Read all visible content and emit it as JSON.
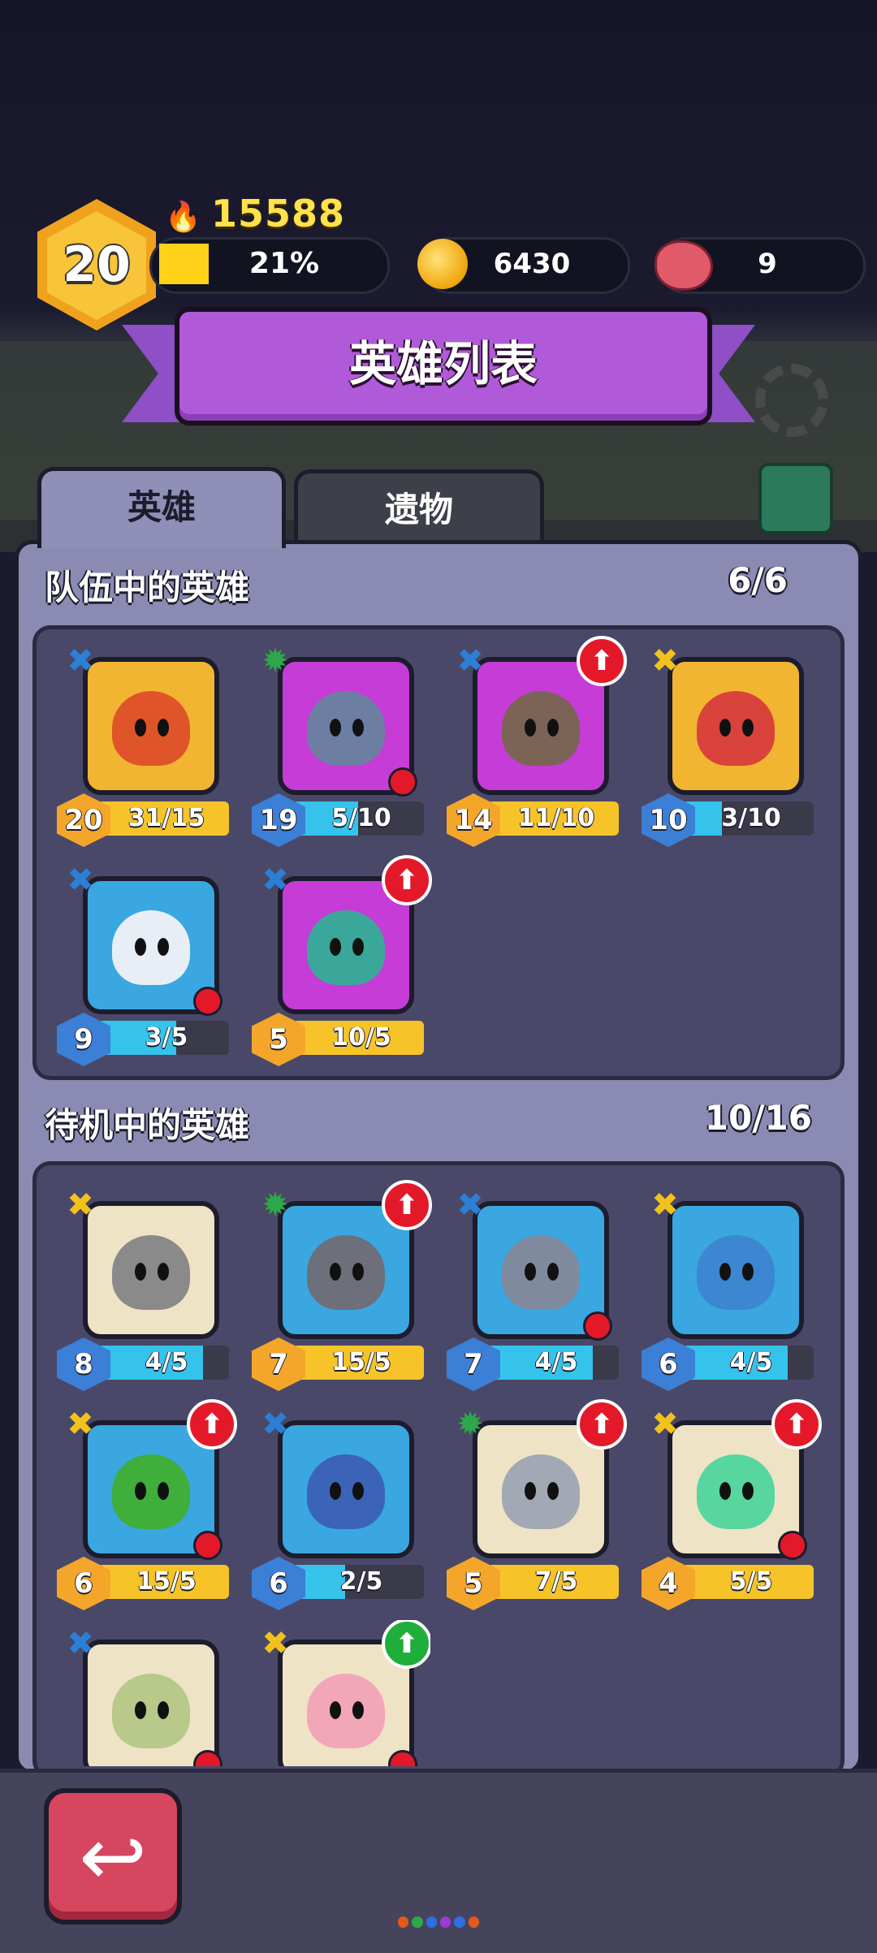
{
  "player": {
    "level": "20",
    "power": "15588",
    "xp_percent": "21%",
    "xp_fraction": 0.21,
    "coins": "6430",
    "meat": "9"
  },
  "title": "英雄列表",
  "tabs": [
    {
      "label": "英雄",
      "active": true
    },
    {
      "label": "遗物",
      "active": false
    }
  ],
  "team": {
    "title": "队伍中的英雄",
    "count": "6/6",
    "heroes": [
      {
        "level": "20",
        "progress": "31/15",
        "element": "wind",
        "upgrade": false,
        "alert": false,
        "bar": "gold",
        "frame": "#f2b531",
        "face": "#e0542a"
      },
      {
        "level": "19",
        "progress": "5/10",
        "element": "nature",
        "upgrade": false,
        "alert": true,
        "bar": "blue",
        "frame": "#c63cd6",
        "face": "#6c7fa3"
      },
      {
        "level": "14",
        "progress": "11/10",
        "element": "wind",
        "upgrade": true,
        "alert": false,
        "bar": "gold",
        "frame": "#c63cd6",
        "face": "#7b6355"
      },
      {
        "level": "10",
        "progress": "3/10",
        "element": "light",
        "upgrade": false,
        "alert": false,
        "bar": "blue",
        "frame": "#f2b531",
        "face": "#d9433b"
      },
      {
        "level": "9",
        "progress": "3/5",
        "element": "wind",
        "upgrade": false,
        "alert": true,
        "bar": "blue",
        "frame": "#3aa7e0",
        "face": "#e8eef5"
      },
      {
        "level": "5",
        "progress": "10/5",
        "element": "wind",
        "upgrade": true,
        "alert": false,
        "bar": "gold",
        "frame": "#c63cd6",
        "face": "#3ba79a"
      }
    ]
  },
  "reserve": {
    "title": "待机中的英雄",
    "count": "10/16",
    "heroes": [
      {
        "level": "8",
        "progress": "4/5",
        "element": "light",
        "upgrade": false,
        "alert": false,
        "bar": "blue",
        "frame": "#efe3c6",
        "face": "#8a8a8a"
      },
      {
        "level": "7",
        "progress": "15/5",
        "element": "nature",
        "upgrade": true,
        "alert": false,
        "bar": "gold",
        "frame": "#3aa7e0",
        "face": "#6d6f7a"
      },
      {
        "level": "7",
        "progress": "4/5",
        "element": "wind",
        "upgrade": false,
        "alert": true,
        "bar": "blue",
        "frame": "#3aa7e0",
        "face": "#808a9f"
      },
      {
        "level": "6",
        "progress": "4/5",
        "element": "light",
        "upgrade": false,
        "alert": false,
        "bar": "blue",
        "frame": "#3aa7e0",
        "face": "#3d86d1"
      },
      {
        "level": "6",
        "progress": "15/5",
        "element": "light",
        "upgrade": true,
        "alert": true,
        "bar": "gold",
        "frame": "#3aa7e0",
        "face": "#3fae3a"
      },
      {
        "level": "6",
        "progress": "2/5",
        "element": "wind",
        "upgrade": false,
        "alert": false,
        "bar": "blue",
        "frame": "#3aa7e0",
        "face": "#3b64b8"
      },
      {
        "level": "5",
        "progress": "7/5",
        "element": "nature",
        "upgrade": true,
        "alert": false,
        "bar": "gold",
        "frame": "#efe3c6",
        "face": "#a3a8b5"
      },
      {
        "level": "4",
        "progress": "5/5",
        "element": "light",
        "upgrade": true,
        "alert": true,
        "bar": "gold",
        "frame": "#efe3c6",
        "face": "#58d6a0"
      },
      {
        "level": "",
        "progress": "",
        "element": "wind",
        "upgrade": false,
        "alert": true,
        "bar": "gold",
        "frame": "#efe3c6",
        "face": "#b8c98a"
      },
      {
        "level": "",
        "progress": "",
        "element": "light",
        "upgrade": true,
        "upgrade_color": "green",
        "alert": true,
        "bar": "gold",
        "frame": "#efe3c6",
        "face": "#f2a7b9"
      }
    ]
  },
  "colors": {
    "gold_bar": "#f6c428",
    "blue_bar": "#35c3ec",
    "gold_badge": "#f4a62a",
    "blue_badge": "#3b7fd6",
    "upgrade_red": "#e3192a",
    "upgrade_green": "#1fae3a"
  }
}
